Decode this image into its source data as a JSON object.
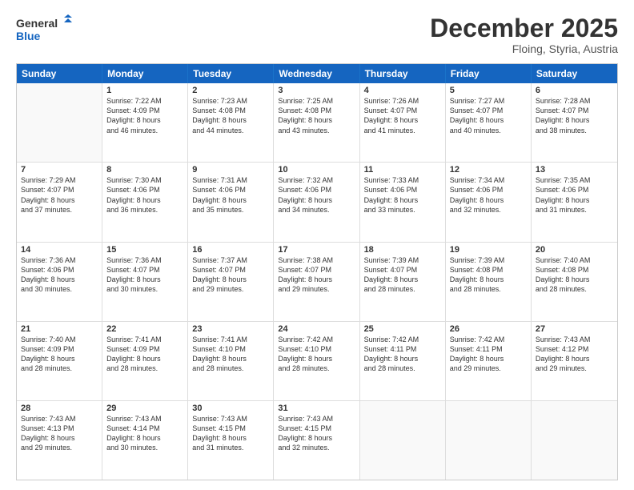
{
  "logo": {
    "line1": "General",
    "line2": "Blue"
  },
  "title": "December 2025",
  "subtitle": "Floing, Styria, Austria",
  "header_days": [
    "Sunday",
    "Monday",
    "Tuesday",
    "Wednesday",
    "Thursday",
    "Friday",
    "Saturday"
  ],
  "weeks": [
    [
      {
        "day": "",
        "lines": []
      },
      {
        "day": "1",
        "lines": [
          "Sunrise: 7:22 AM",
          "Sunset: 4:09 PM",
          "Daylight: 8 hours",
          "and 46 minutes."
        ]
      },
      {
        "day": "2",
        "lines": [
          "Sunrise: 7:23 AM",
          "Sunset: 4:08 PM",
          "Daylight: 8 hours",
          "and 44 minutes."
        ]
      },
      {
        "day": "3",
        "lines": [
          "Sunrise: 7:25 AM",
          "Sunset: 4:08 PM",
          "Daylight: 8 hours",
          "and 43 minutes."
        ]
      },
      {
        "day": "4",
        "lines": [
          "Sunrise: 7:26 AM",
          "Sunset: 4:07 PM",
          "Daylight: 8 hours",
          "and 41 minutes."
        ]
      },
      {
        "day": "5",
        "lines": [
          "Sunrise: 7:27 AM",
          "Sunset: 4:07 PM",
          "Daylight: 8 hours",
          "and 40 minutes."
        ]
      },
      {
        "day": "6",
        "lines": [
          "Sunrise: 7:28 AM",
          "Sunset: 4:07 PM",
          "Daylight: 8 hours",
          "and 38 minutes."
        ]
      }
    ],
    [
      {
        "day": "7",
        "lines": [
          "Sunrise: 7:29 AM",
          "Sunset: 4:07 PM",
          "Daylight: 8 hours",
          "and 37 minutes."
        ]
      },
      {
        "day": "8",
        "lines": [
          "Sunrise: 7:30 AM",
          "Sunset: 4:06 PM",
          "Daylight: 8 hours",
          "and 36 minutes."
        ]
      },
      {
        "day": "9",
        "lines": [
          "Sunrise: 7:31 AM",
          "Sunset: 4:06 PM",
          "Daylight: 8 hours",
          "and 35 minutes."
        ]
      },
      {
        "day": "10",
        "lines": [
          "Sunrise: 7:32 AM",
          "Sunset: 4:06 PM",
          "Daylight: 8 hours",
          "and 34 minutes."
        ]
      },
      {
        "day": "11",
        "lines": [
          "Sunrise: 7:33 AM",
          "Sunset: 4:06 PM",
          "Daylight: 8 hours",
          "and 33 minutes."
        ]
      },
      {
        "day": "12",
        "lines": [
          "Sunrise: 7:34 AM",
          "Sunset: 4:06 PM",
          "Daylight: 8 hours",
          "and 32 minutes."
        ]
      },
      {
        "day": "13",
        "lines": [
          "Sunrise: 7:35 AM",
          "Sunset: 4:06 PM",
          "Daylight: 8 hours",
          "and 31 minutes."
        ]
      }
    ],
    [
      {
        "day": "14",
        "lines": [
          "Sunrise: 7:36 AM",
          "Sunset: 4:06 PM",
          "Daylight: 8 hours",
          "and 30 minutes."
        ]
      },
      {
        "day": "15",
        "lines": [
          "Sunrise: 7:36 AM",
          "Sunset: 4:07 PM",
          "Daylight: 8 hours",
          "and 30 minutes."
        ]
      },
      {
        "day": "16",
        "lines": [
          "Sunrise: 7:37 AM",
          "Sunset: 4:07 PM",
          "Daylight: 8 hours",
          "and 29 minutes."
        ]
      },
      {
        "day": "17",
        "lines": [
          "Sunrise: 7:38 AM",
          "Sunset: 4:07 PM",
          "Daylight: 8 hours",
          "and 29 minutes."
        ]
      },
      {
        "day": "18",
        "lines": [
          "Sunrise: 7:39 AM",
          "Sunset: 4:07 PM",
          "Daylight: 8 hours",
          "and 28 minutes."
        ]
      },
      {
        "day": "19",
        "lines": [
          "Sunrise: 7:39 AM",
          "Sunset: 4:08 PM",
          "Daylight: 8 hours",
          "and 28 minutes."
        ]
      },
      {
        "day": "20",
        "lines": [
          "Sunrise: 7:40 AM",
          "Sunset: 4:08 PM",
          "Daylight: 8 hours",
          "and 28 minutes."
        ]
      }
    ],
    [
      {
        "day": "21",
        "lines": [
          "Sunrise: 7:40 AM",
          "Sunset: 4:09 PM",
          "Daylight: 8 hours",
          "and 28 minutes."
        ]
      },
      {
        "day": "22",
        "lines": [
          "Sunrise: 7:41 AM",
          "Sunset: 4:09 PM",
          "Daylight: 8 hours",
          "and 28 minutes."
        ]
      },
      {
        "day": "23",
        "lines": [
          "Sunrise: 7:41 AM",
          "Sunset: 4:10 PM",
          "Daylight: 8 hours",
          "and 28 minutes."
        ]
      },
      {
        "day": "24",
        "lines": [
          "Sunrise: 7:42 AM",
          "Sunset: 4:10 PM",
          "Daylight: 8 hours",
          "and 28 minutes."
        ]
      },
      {
        "day": "25",
        "lines": [
          "Sunrise: 7:42 AM",
          "Sunset: 4:11 PM",
          "Daylight: 8 hours",
          "and 28 minutes."
        ]
      },
      {
        "day": "26",
        "lines": [
          "Sunrise: 7:42 AM",
          "Sunset: 4:11 PM",
          "Daylight: 8 hours",
          "and 29 minutes."
        ]
      },
      {
        "day": "27",
        "lines": [
          "Sunrise: 7:43 AM",
          "Sunset: 4:12 PM",
          "Daylight: 8 hours",
          "and 29 minutes."
        ]
      }
    ],
    [
      {
        "day": "28",
        "lines": [
          "Sunrise: 7:43 AM",
          "Sunset: 4:13 PM",
          "Daylight: 8 hours",
          "and 29 minutes."
        ]
      },
      {
        "day": "29",
        "lines": [
          "Sunrise: 7:43 AM",
          "Sunset: 4:14 PM",
          "Daylight: 8 hours",
          "and 30 minutes."
        ]
      },
      {
        "day": "30",
        "lines": [
          "Sunrise: 7:43 AM",
          "Sunset: 4:15 PM",
          "Daylight: 8 hours",
          "and 31 minutes."
        ]
      },
      {
        "day": "31",
        "lines": [
          "Sunrise: 7:43 AM",
          "Sunset: 4:15 PM",
          "Daylight: 8 hours",
          "and 32 minutes."
        ]
      },
      {
        "day": "",
        "lines": []
      },
      {
        "day": "",
        "lines": []
      },
      {
        "day": "",
        "lines": []
      }
    ]
  ]
}
